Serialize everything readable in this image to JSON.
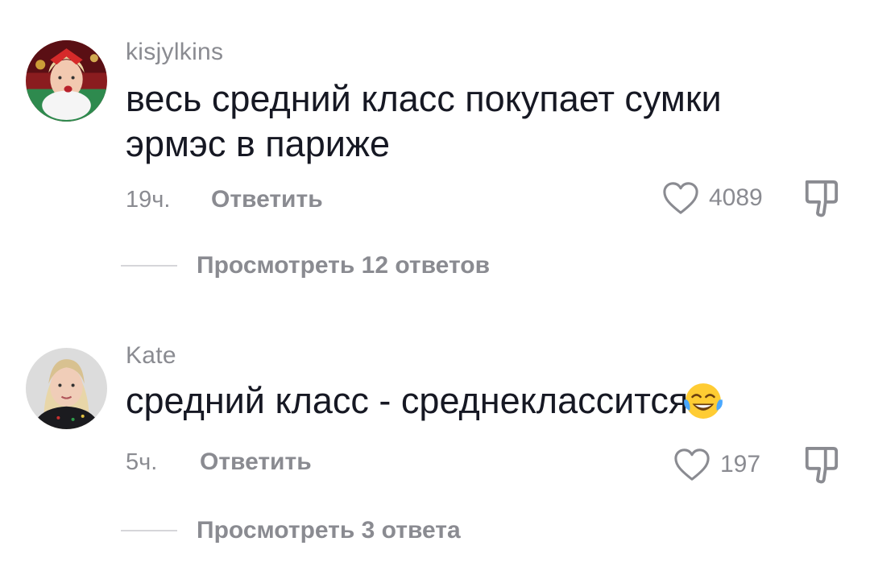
{
  "comments": [
    {
      "username": "kisjylkins",
      "text": "весь средний класс покупает сумки эрмэс в париже",
      "time": "19ч.",
      "reply_label": "Ответить",
      "likes": "4089",
      "view_replies_label": "Просмотреть 12 ответов"
    },
    {
      "username": "Kate",
      "text": "средний класс - среднеклассится",
      "emoji": "face-with-tears-of-joy",
      "time": "5ч.",
      "reply_label": "Ответить",
      "likes": "197",
      "view_replies_label": "Просмотреть 3 ответа"
    }
  ],
  "icons": {
    "like": "heart-outline-icon",
    "dislike": "thumbs-down-outline-icon"
  },
  "colors": {
    "text_primary": "#161823",
    "text_secondary": "#8a8b91",
    "divider": "#d6d6d9",
    "emoji_face": "#ffcc33",
    "emoji_tears": "#4aa8ff"
  }
}
